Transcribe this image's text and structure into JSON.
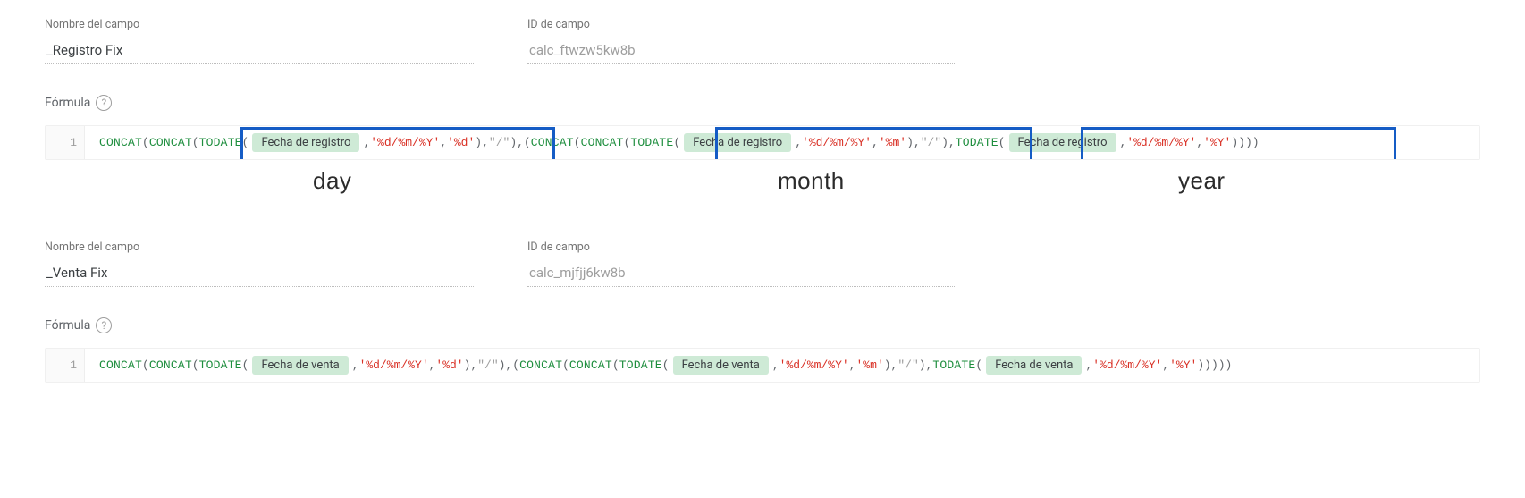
{
  "labels": {
    "field_name": "Nombre del campo",
    "field_id": "ID de campo",
    "formula": "Fórmula"
  },
  "help_glyph": "?",
  "gutter_line": "1",
  "field1": {
    "name_value": "_Registro Fix",
    "id_value": "calc_ftwzw5kw8b",
    "formula": {
      "func_concat": "CONCAT",
      "func_todate": "TODATE",
      "chip": "Fecha de registro",
      "fmt": "'%d/%m/%Y'",
      "out_day": "'%d'",
      "out_month": "'%m'",
      "out_year": "'%Y'",
      "slash": "\"/\"",
      "comma": ", ",
      "open": "(",
      "close": ")",
      "close3": ")))",
      "close4": "))))"
    }
  },
  "annotations": {
    "day": "day",
    "month": "month",
    "year": "year"
  },
  "field2": {
    "name_value": "_Venta Fix",
    "id_value": "calc_mjfjj6kw8b",
    "formula": {
      "func_concat": "CONCAT",
      "func_todate": "TODATE",
      "chip": "Fecha de venta",
      "fmt": "'%d/%m/%Y'",
      "out_day": "'%d'",
      "out_month": "'%m'",
      "out_year": "'%Y'",
      "slash": "\"/\"",
      "comma": ", ",
      "open": "(",
      "close": ")",
      "close4": "))))"
    }
  }
}
